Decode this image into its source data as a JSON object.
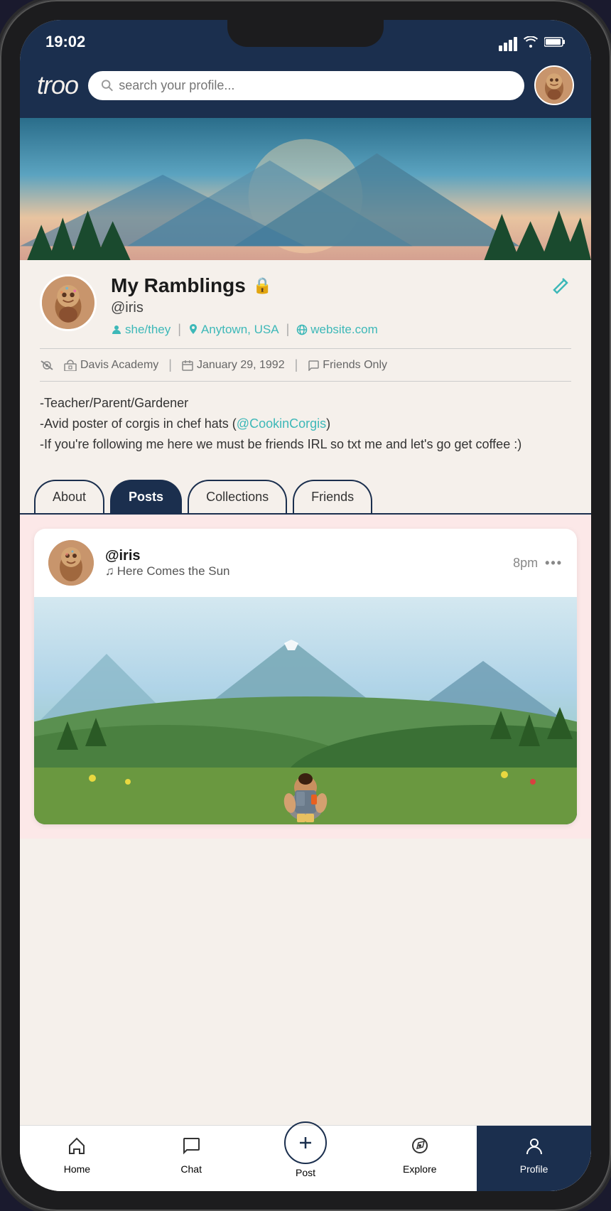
{
  "status": {
    "time": "19:02"
  },
  "header": {
    "logo": "troo",
    "search_placeholder": "search your profile..."
  },
  "profile": {
    "display_name": "My Ramblings",
    "username": "@iris",
    "pronouns": "she/they",
    "location": "Anytown, USA",
    "website": "website.com",
    "school": "Davis Academy",
    "birthday": "January 29, 1992",
    "visibility": "Friends Only",
    "bio_line1": "-Teacher/Parent/Gardener",
    "bio_line2": "-Avid poster of corgis in chef hats (",
    "bio_link": "@CookinCorgis",
    "bio_line2_end": ")",
    "bio_line3": "-If you're following me here we must be friends IRL so txt me and let's go get coffee :)"
  },
  "tabs": {
    "items": [
      {
        "label": "About",
        "active": false
      },
      {
        "label": "Posts",
        "active": true
      },
      {
        "label": "Collections",
        "active": false
      },
      {
        "label": "Friends",
        "active": false
      }
    ]
  },
  "post": {
    "username": "@iris",
    "song": "Here Comes the Sun",
    "time": "8pm",
    "more_icon": "•••"
  },
  "nav": {
    "items": [
      {
        "label": "Home",
        "icon": "⌂",
        "active": false
      },
      {
        "label": "Chat",
        "icon": "💬",
        "active": false
      },
      {
        "label": "Post",
        "icon": "+",
        "active": false,
        "special": true
      },
      {
        "label": "Explore",
        "icon": "◎",
        "active": false
      },
      {
        "label": "Profile",
        "icon": "👤",
        "active": true
      }
    ]
  }
}
